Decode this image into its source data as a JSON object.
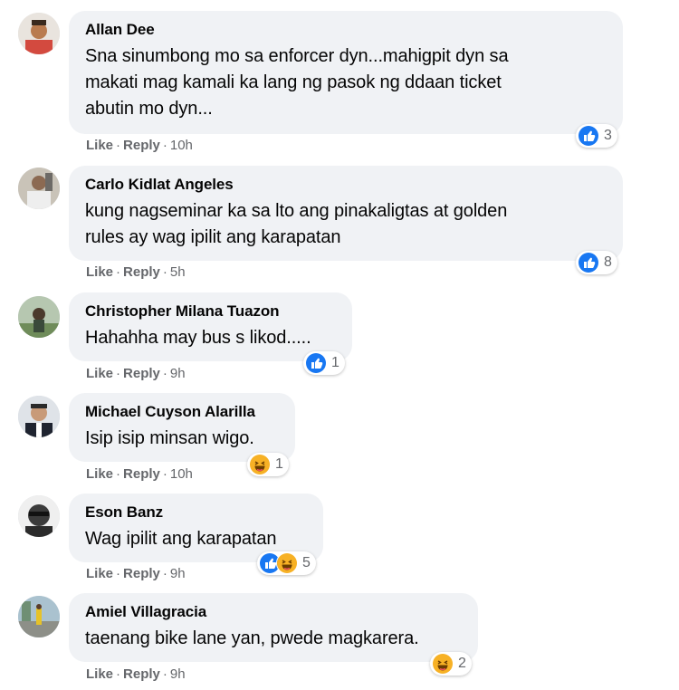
{
  "labels": {
    "like": "Like",
    "reply": "Reply",
    "separator": "·"
  },
  "colors": {
    "like_blue": "#1877f2",
    "haha_yellow": "#f7b125",
    "bubble_bg": "#f0f2f5",
    "meta_gray": "#65676b"
  },
  "comments": [
    {
      "author": "Allan Dee",
      "lines": [
        "Sna sinumbong mo sa enforcer dyn...mahigpit dyn sa",
        "makati mag kamali ka lang ng pasok ng ddaan ticket",
        "abutin mo dyn..."
      ],
      "time": "10h",
      "reactions": [
        "like-icon"
      ],
      "reaction_count": "3"
    },
    {
      "author": "Carlo Kidlat Angeles",
      "lines": [
        "kung nagseminar ka sa lto ang pinakaligtas at golden",
        "rules ay wag ipilit ang karapatan"
      ],
      "time": "5h",
      "reactions": [
        "like-icon"
      ],
      "reaction_count": "8"
    },
    {
      "author": "Christopher Milana Tuazon",
      "lines": [
        "Hahahha may bus s likod....."
      ],
      "time": "9h",
      "reactions": [
        "like-icon"
      ],
      "reaction_count": "1"
    },
    {
      "author": "Michael Cuyson Alarilla",
      "lines": [
        "Isip isip minsan wigo."
      ],
      "time": "10h",
      "reactions": [
        "haha-icon"
      ],
      "reaction_count": "1"
    },
    {
      "author": "Eson Banz",
      "lines": [
        "Wag ipilit ang karapatan"
      ],
      "time": "9h",
      "reactions": [
        "like-icon",
        "haha-icon"
      ],
      "reaction_count": "5"
    },
    {
      "author": "Amiel Villagracia",
      "lines": [
        "taenang bike lane yan, pwede magkarera."
      ],
      "time": "9h",
      "reactions": [
        "haha-icon"
      ],
      "reaction_count": "2"
    }
  ]
}
